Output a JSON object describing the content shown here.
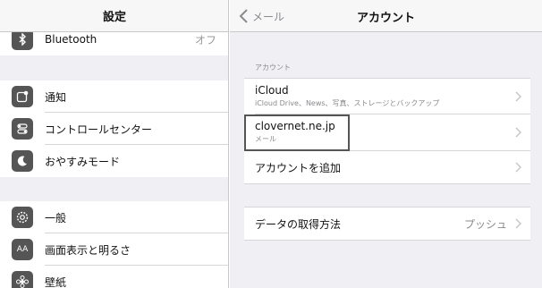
{
  "left": {
    "title": "設定",
    "bluetooth": {
      "label": "Bluetooth",
      "value": "オフ"
    },
    "items_group1": [
      {
        "label": "通知",
        "icon": "notifications-icon"
      },
      {
        "label": "コントロールセンター",
        "icon": "control-center-icon"
      },
      {
        "label": "おやすみモード",
        "icon": "moon-icon"
      }
    ],
    "items_group2": [
      {
        "label": "一般",
        "icon": "gear-icon"
      },
      {
        "label": "画面表示と明るさ",
        "icon": "display-icon",
        "icon_text": "AA"
      },
      {
        "label": "壁紙",
        "icon": "wallpaper-icon"
      }
    ]
  },
  "right": {
    "back_label": "メール",
    "title": "アカウント",
    "section_label": "アカウント",
    "accounts": [
      {
        "title": "iCloud",
        "subtitle": "iCloud Drive、News、写真、ストレージとバックアップ"
      },
      {
        "title": "clovernet.ne.jp",
        "subtitle": "メール"
      },
      {
        "title": "アカウントを追加"
      }
    ],
    "fetch": {
      "label": "データの取得方法",
      "value": "プッシュ"
    }
  },
  "colors": {
    "background": "#efeff4",
    "separator": "#d6d6da",
    "secondary_text": "#8a8a8f"
  }
}
